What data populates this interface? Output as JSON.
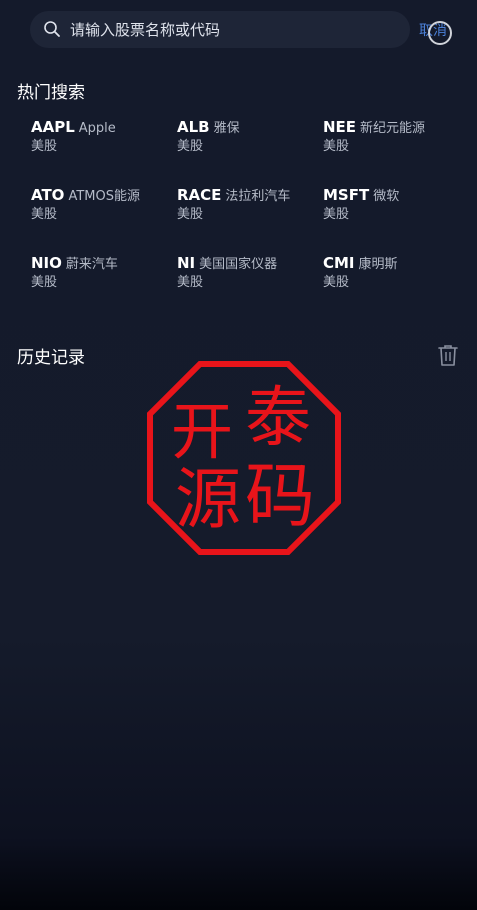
{
  "search": {
    "placeholder": "请输入股票名称或代码",
    "cancel_label": "取消"
  },
  "hot": {
    "title": "热门搜索",
    "items": [
      {
        "code": "AAPL",
        "name": "Apple",
        "market": "美股"
      },
      {
        "code": "ALB",
        "name": "雅保",
        "market": "美股"
      },
      {
        "code": "NEE",
        "name": "新纪元能源",
        "market": "美股"
      },
      {
        "code": "ATO",
        "name": "ATMOS能源",
        "market": "美股"
      },
      {
        "code": "RACE",
        "name": "法拉利汽车",
        "market": "美股"
      },
      {
        "code": "MSFT",
        "name": "微软",
        "market": "美股"
      },
      {
        "code": "NIO",
        "name": "蔚来汽车",
        "market": "美股"
      },
      {
        "code": "NI",
        "name": "美国国家仪器",
        "market": "美股"
      },
      {
        "code": "CMI",
        "name": "康明斯",
        "market": "美股"
      }
    ]
  },
  "history": {
    "title": "历史记录"
  },
  "watermark": {
    "chars": [
      "开",
      "泰",
      "源",
      "码"
    ],
    "color": "#e8141a"
  },
  "colors": {
    "background": "#151b2b",
    "search_bg": "#1e2537",
    "accent": "#4a7fd6",
    "secondary_text": "#b5bbc8"
  },
  "icons": {
    "search": "search-icon",
    "trash": "trash-icon"
  }
}
